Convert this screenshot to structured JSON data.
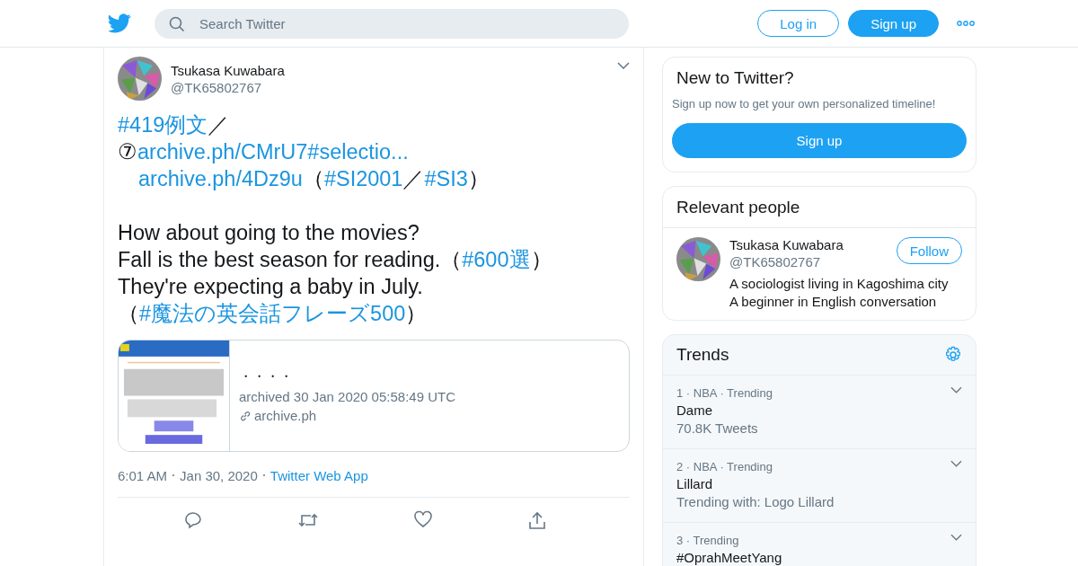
{
  "header": {
    "search": {
      "placeholder": "Search Twitter"
    },
    "login": "Log in",
    "signup": "Sign up"
  },
  "tweet": {
    "author": {
      "name": "Tsukasa Kuwabara",
      "handle": "@TK65802767"
    },
    "lines": [
      [
        {
          "kind": "link",
          "text": "#419例文"
        },
        {
          "kind": "text",
          "text": "／"
        }
      ],
      [
        {
          "kind": "text",
          "text": "⑦"
        },
        {
          "kind": "link",
          "text": "archive.ph/CMrU7#selectio..."
        }
      ],
      [
        {
          "kind": "indent"
        },
        {
          "kind": "link",
          "text": "archive.ph/4Dz9u"
        },
        {
          "kind": "text",
          "text": "（"
        },
        {
          "kind": "link",
          "text": "#SI2001"
        },
        {
          "kind": "text",
          "text": "／"
        },
        {
          "kind": "link",
          "text": "#SI3"
        },
        {
          "kind": "text",
          "text": "）"
        }
      ],
      [
        {
          "kind": "blank"
        }
      ],
      [
        {
          "kind": "text",
          "text": "How about going to the movies?"
        }
      ],
      [
        {
          "kind": "text",
          "text": "Fall is the best season for reading.（"
        },
        {
          "kind": "link",
          "text": "#600選"
        },
        {
          "kind": "text",
          "text": "）"
        }
      ],
      [
        {
          "kind": "text",
          "text": "They're expecting a baby in July.（"
        },
        {
          "kind": "link",
          "text": "#魔法の英会話フレーズ500"
        },
        {
          "kind": "text",
          "text": "）"
        }
      ]
    ],
    "card": {
      "title": "・・・・",
      "subtitle": "archived 30 Jan 2020 05:58:49 UTC",
      "domain": "archive.ph"
    },
    "time": "6:01 AM",
    "date": "Jan 30, 2020",
    "source": "Twitter Web App"
  },
  "signup_card": {
    "title": "New to Twitter?",
    "text": "Sign up now to get your own personalized timeline!",
    "button": "Sign up"
  },
  "relevant": {
    "title": "Relevant people",
    "people": [
      {
        "name": "Tsukasa Kuwabara",
        "handle": "@TK65802767",
        "button": "Follow",
        "bio": [
          "A sociologist living in Kagoshima city",
          "A beginner in English conversation"
        ]
      }
    ]
  },
  "trends": {
    "title": "Trends",
    "items": [
      {
        "meta": "1 · NBA · Trending",
        "name": "Dame",
        "detail": "70.8K Tweets"
      },
      {
        "meta": "2 · NBA · Trending",
        "name": "Lillard",
        "detail": "Trending with: Logo Lillard"
      },
      {
        "meta": "3 · Trending",
        "name": "#OprahMeetYang"
      }
    ]
  }
}
